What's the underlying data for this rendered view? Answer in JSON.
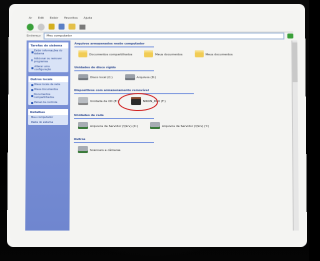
{
  "menu": [
    "Ar",
    "Edit",
    "Exibir",
    "Favoritos",
    "Ajuda"
  ],
  "address": {
    "label": "Endereço",
    "value": "Meu computador"
  },
  "taskpane": {
    "boxes": [
      {
        "title": "Tarefas do sistema",
        "items": [
          "Exibir informações do sistema",
          "Adicionar ou remover programas",
          "Alterar uma configuração"
        ]
      },
      {
        "title": "Outros locais",
        "items": [
          "Meus locais de rede",
          "Meus documentos",
          "Documentos compartilhados",
          "Painel de controle"
        ]
      },
      {
        "title": "Detalhes",
        "items": [
          "Meu computador",
          "Pasta do sistema"
        ]
      }
    ]
  },
  "content": {
    "groups": [
      {
        "title": "Arquivos armazenados neste computador",
        "items": [
          {
            "icon": "folder-icon",
            "label": "Documentos compartilhados"
          },
          {
            "icon": "folder-icon",
            "label": "Meus documentos"
          },
          {
            "icon": "folder-icon",
            "label": "Meus documentos"
          }
        ]
      },
      {
        "title": "Unidades de disco rígido",
        "items": [
          {
            "icon": "drive-icon",
            "label": "Disco local (C:)"
          },
          {
            "icon": "drive-icon",
            "label": "Arquivos (D:)"
          }
        ]
      },
      {
        "title": "Dispositivos com armazenamento removível",
        "items": [
          {
            "icon": "removable-icon",
            "label": "Unidade de CD (E:)"
          },
          {
            "icon": "camera-icon",
            "label": "NIKON_D60 (F:)"
          }
        ]
      },
      {
        "title": "Unidades de rede",
        "items": [
          {
            "icon": "network-drive-icon",
            "label": "Arquivos de Servidor (\\\\Srv) (X:)"
          },
          {
            "icon": "network-drive-icon",
            "label": "Arquivos de Servidor (\\\\Srv) (Y:)"
          }
        ]
      },
      {
        "title": "Outros",
        "items": [
          {
            "icon": "scanner-icon",
            "label": "Scanners e câmeras"
          }
        ]
      }
    ]
  },
  "colors": {
    "taskpane_bg": "#7c93d8",
    "taskpane_box": "#d9e3f7",
    "link_blue": "#1c3b8a",
    "folder_yellow": "#f1cc55",
    "highlight_red": "#d02020"
  }
}
